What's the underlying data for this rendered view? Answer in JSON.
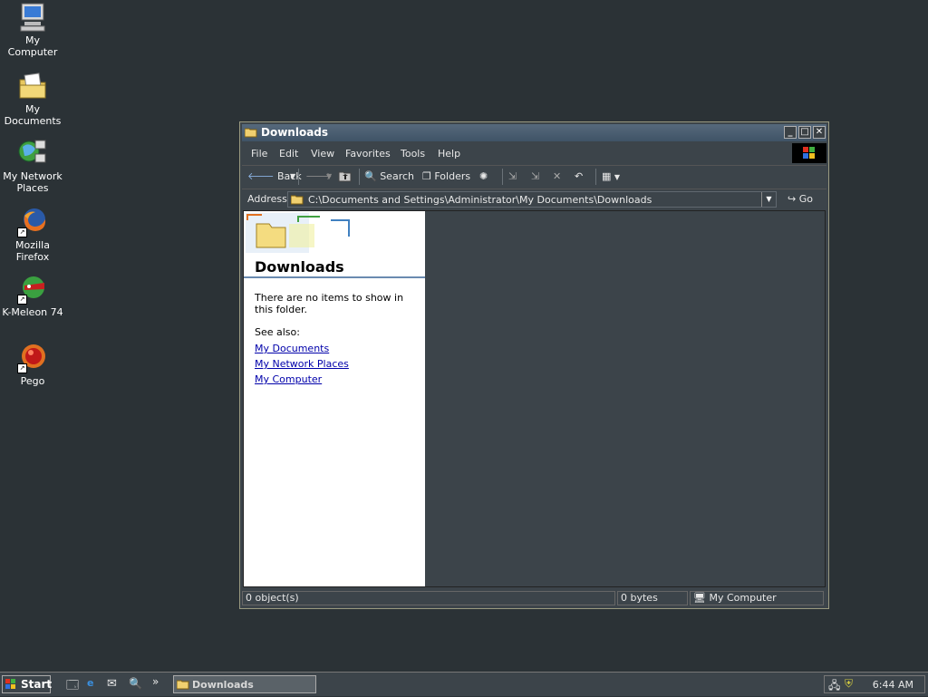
{
  "desktop": {
    "icons": [
      {
        "label": "My Computer"
      },
      {
        "label": "My Documents"
      },
      {
        "label": "My Network Places"
      },
      {
        "label": "Mozilla Firefox"
      },
      {
        "label": "K-Meleon 74"
      },
      {
        "label": "Pego"
      }
    ]
  },
  "window": {
    "title": "Downloads",
    "menu": [
      "File",
      "Edit",
      "View",
      "Favorites",
      "Tools",
      "Help"
    ],
    "toolbar": {
      "back": "Back",
      "search": "Search",
      "folders": "Folders"
    },
    "address": {
      "label": "Address",
      "value": "C:\\Documents and Settings\\Administrator\\My Documents\\Downloads",
      "go": "Go"
    },
    "left_pane": {
      "title": "Downloads",
      "message": "There are no items to show in this folder.",
      "see_also": "See also:",
      "links": [
        "My Documents",
        "My Network Places",
        "My Computer"
      ]
    },
    "status": {
      "objects": "0 object(s)",
      "size": "0 bytes",
      "zone": "My Computer"
    }
  },
  "taskbar": {
    "start": "Start",
    "chevron": "»",
    "task": "Downloads",
    "clock": "6:44 AM"
  },
  "colors": {
    "desktop": "#2b3236",
    "window": "#3c444a",
    "titlebar": "#4a5e72",
    "link": "#0000aa"
  }
}
